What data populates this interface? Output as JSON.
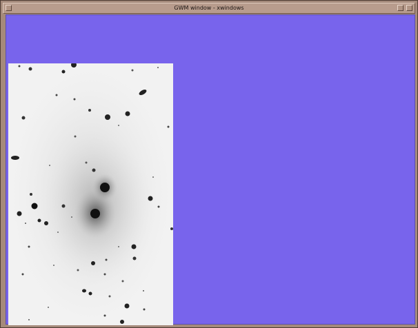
{
  "window": {
    "title": "GWM window - xwindows"
  },
  "icons": {
    "menu": "window-menu-icon",
    "minimize": "minimize-icon",
    "maximize": "maximize-icon"
  },
  "colors": {
    "background": "#7864ec",
    "frame": "#a58a7b"
  }
}
